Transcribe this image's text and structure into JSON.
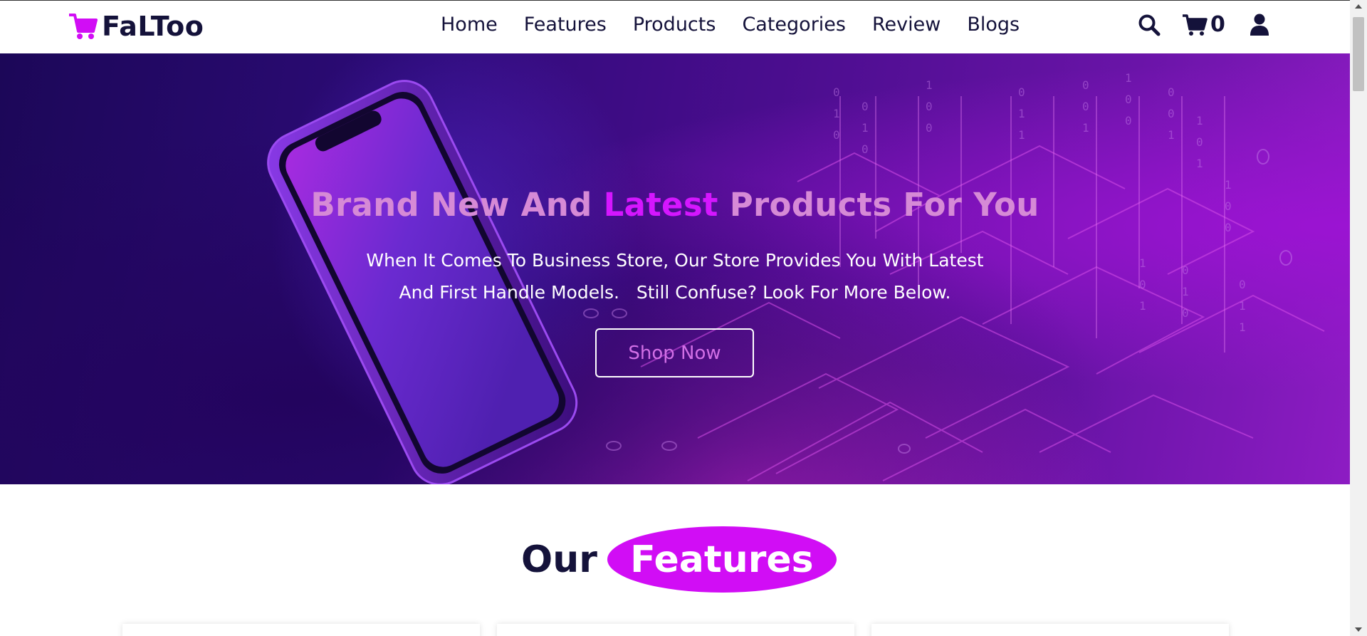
{
  "brand": {
    "name": "FaLToo",
    "logo_icon": "shopping-cart-icon",
    "color": "#d10df5"
  },
  "nav": {
    "items": [
      {
        "label": "Home"
      },
      {
        "label": "Features"
      },
      {
        "label": "Products"
      },
      {
        "label": "Categories"
      },
      {
        "label": "Review"
      },
      {
        "label": "Blogs"
      }
    ]
  },
  "header_icons": {
    "search": "search-icon",
    "cart": "cart-icon",
    "cart_count": "0",
    "user": "user-icon"
  },
  "hero": {
    "title_part1": "Brand New And ",
    "title_accent": "Latest",
    "title_part2": " Products For You",
    "subtitle_line1": "When It Comes To Business Store, Our Store Provides You With Latest",
    "subtitle_line2": "And First Handle Models.   Still Confuse? Look For More Below.",
    "button_label": "Shop Now"
  },
  "features": {
    "heading_word1": "Our",
    "heading_word2": "Features"
  },
  "colors": {
    "accent": "#d10df5",
    "dark_text": "#14123a",
    "title_pink": "#d68ad6"
  }
}
